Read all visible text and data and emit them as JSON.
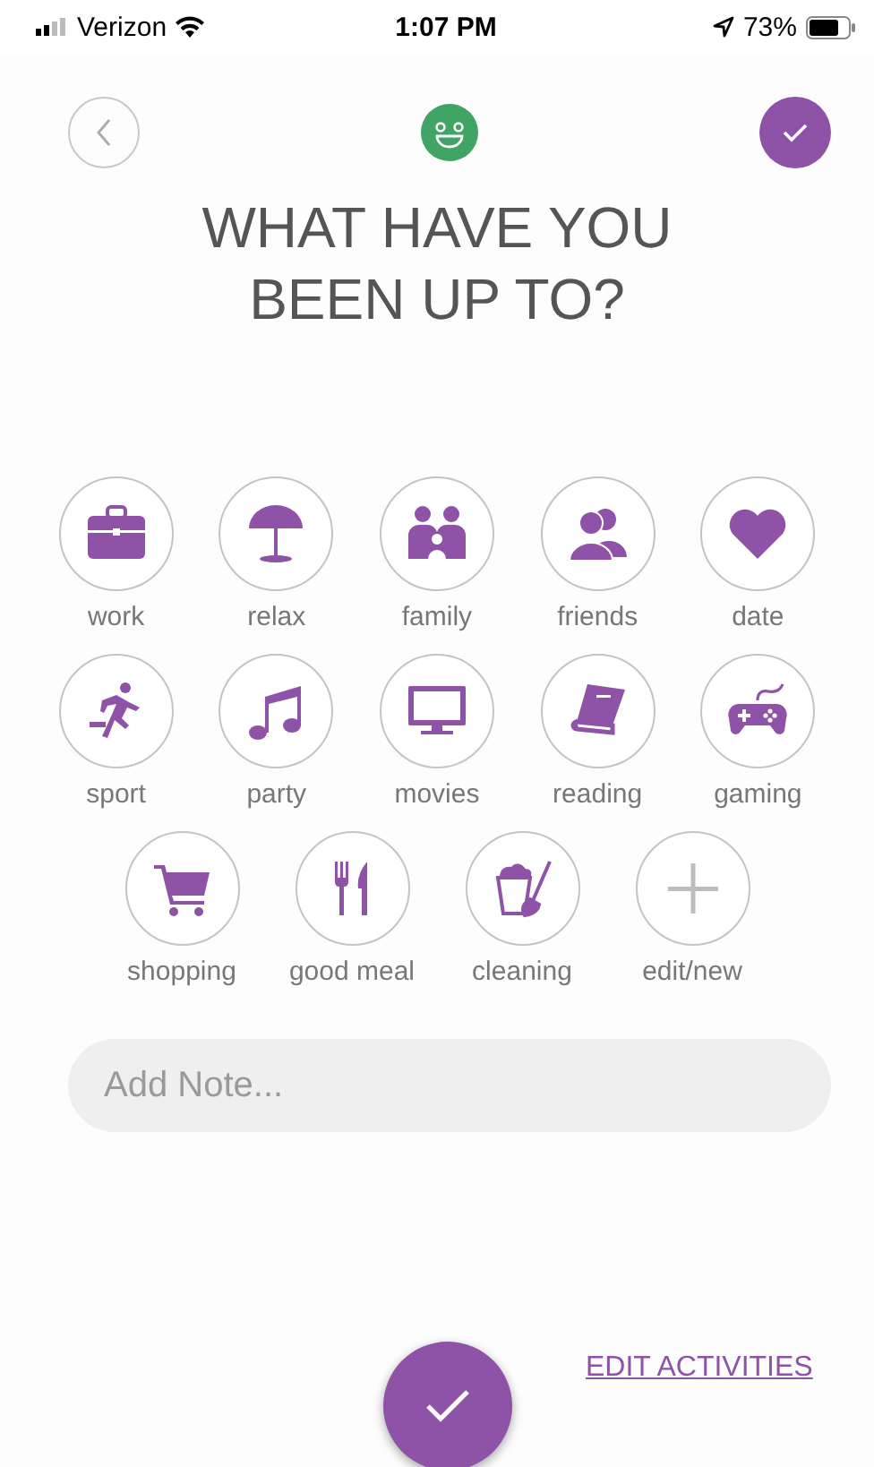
{
  "status_bar": {
    "carrier": "Verizon",
    "time": "1:07 PM",
    "battery": "73%"
  },
  "title": "WHAT HAVE YOU BEEN UP TO?",
  "activity_rows": [
    [
      {
        "label": "work",
        "kind": "briefcase"
      },
      {
        "label": "relax",
        "kind": "umbrella"
      },
      {
        "label": "family",
        "kind": "family"
      },
      {
        "label": "friends",
        "kind": "friends"
      },
      {
        "label": "date",
        "kind": "heart"
      }
    ],
    [
      {
        "label": "sport",
        "kind": "runner"
      },
      {
        "label": "party",
        "kind": "music"
      },
      {
        "label": "movies",
        "kind": "tv"
      },
      {
        "label": "reading",
        "kind": "book"
      },
      {
        "label": "gaming",
        "kind": "gamepad"
      }
    ],
    [
      {
        "label": "shopping",
        "kind": "cart"
      },
      {
        "label": "good meal",
        "kind": "cutlery"
      },
      {
        "label": "cleaning",
        "kind": "cleaning"
      },
      {
        "label": "edit/new",
        "kind": "add"
      }
    ]
  ],
  "note": {
    "placeholder": "Add Note..."
  },
  "edit_link": "EDIT ACTIVITIES"
}
